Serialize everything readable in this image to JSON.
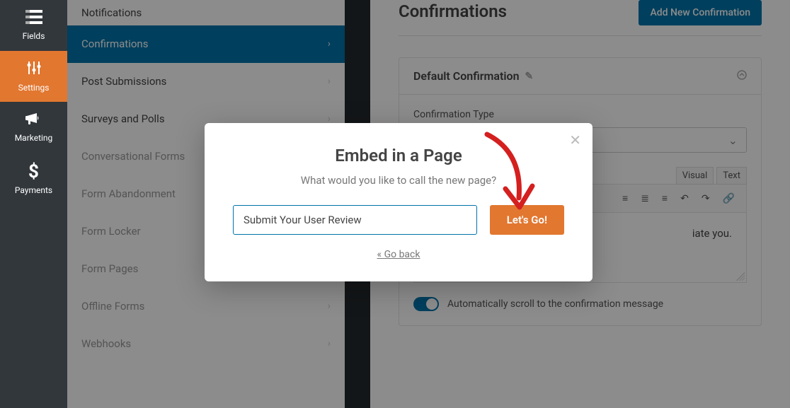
{
  "leftnav": {
    "items": [
      {
        "icon": "≣",
        "label": "Fields"
      },
      {
        "icon": "⚙",
        "label": "Settings"
      },
      {
        "icon": "📢",
        "label": "Marketing"
      },
      {
        "icon": "$",
        "label": "Payments"
      }
    ]
  },
  "sidebar": {
    "items": [
      "Notifications",
      "Confirmations",
      "Post Submissions",
      "Surveys and Polls",
      "Conversational Forms",
      "Form Abandonment",
      "Form Locker",
      "Form Pages",
      "Offline Forms",
      "Webhooks"
    ]
  },
  "page": {
    "title": "Confirmations",
    "add_button": "Add New Confirmation"
  },
  "panel": {
    "title": "Default Confirmation",
    "field_label": "Confirmation Type",
    "editor_tabs": {
      "visual": "Visual",
      "text": "Text"
    },
    "editor_content": "iate you.",
    "toggle_label": "Automatically scroll to the confirmation message"
  },
  "modal": {
    "title": "Embed in a Page",
    "subtitle": "What would you like to call the new page?",
    "input_value": "Submit Your User Review",
    "go_label": "Let's Go!",
    "back_label": "« Go back"
  }
}
